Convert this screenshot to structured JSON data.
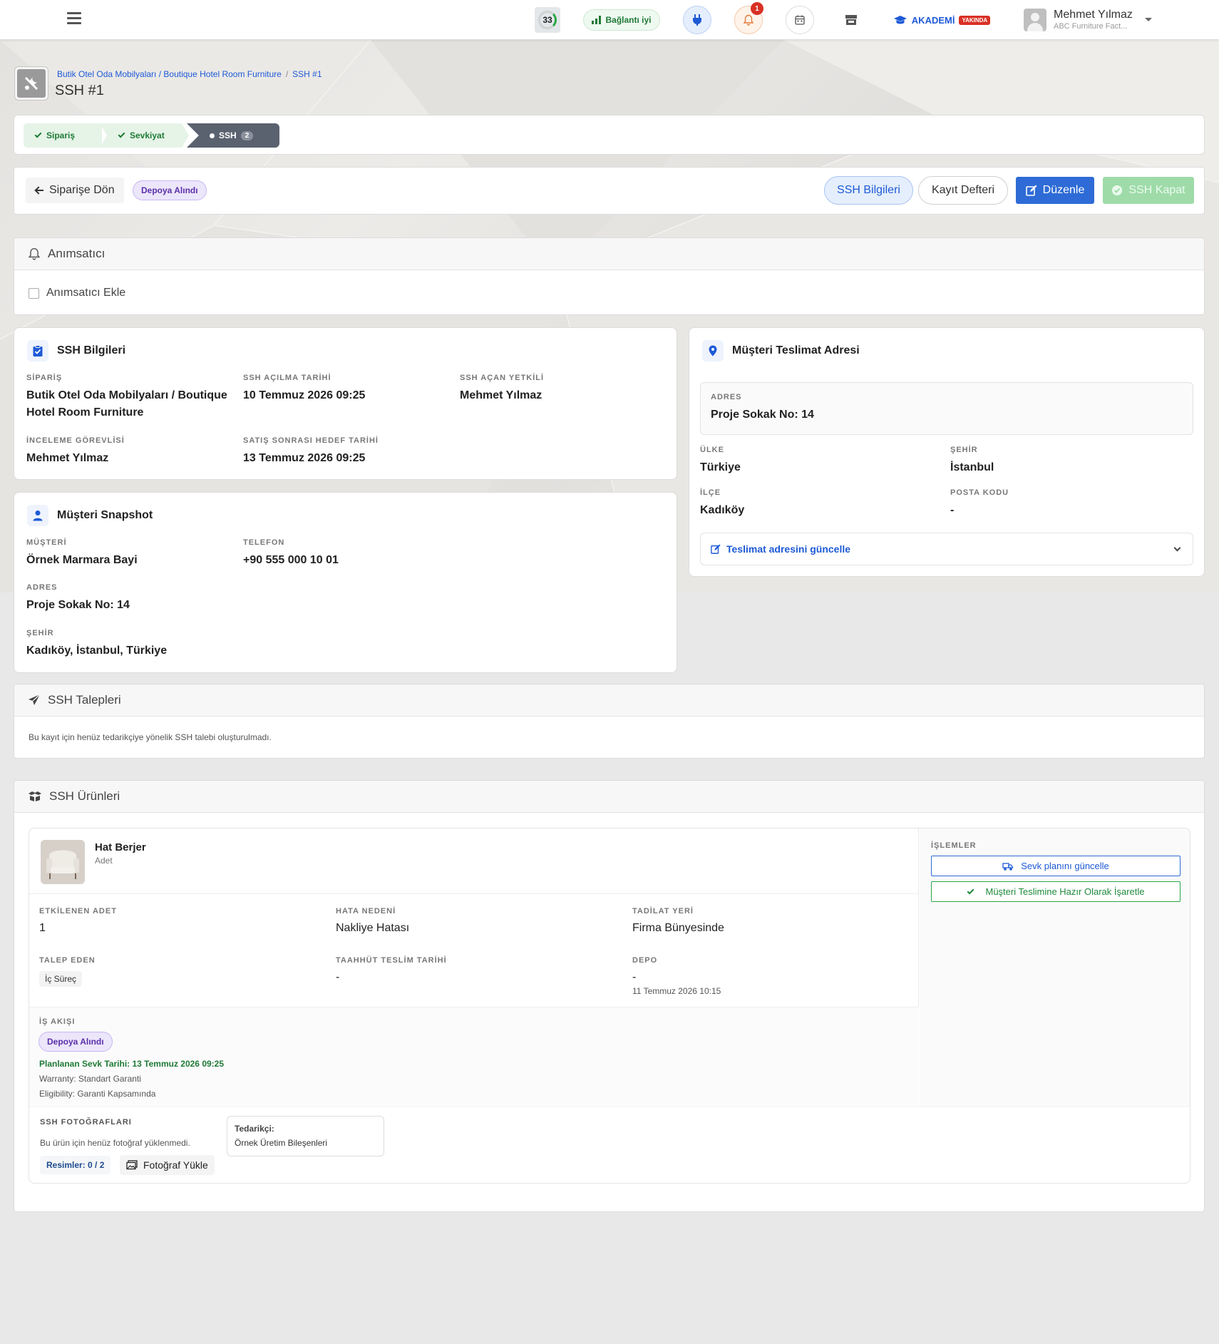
{
  "topbar": {
    "counter": "33",
    "connection": "Bağlantı iyi",
    "notification_count": "1",
    "akademi": "AKADEMİ",
    "akademi_badge": "YAKINDA",
    "user_name": "Mehmet Yılmaz",
    "user_company": "ABC Furniture Fact..."
  },
  "header": {
    "breadcrumb": [
      "Butik Otel Oda Mobilyaları / Boutique Hotel Room Furniture",
      "SSH #1"
    ],
    "title": "SSH #1"
  },
  "steps": [
    {
      "label": "Sipariş",
      "state": "done"
    },
    {
      "label": "Sevkiyat",
      "state": "done"
    },
    {
      "label": "SSH",
      "state": "active",
      "count": "2"
    }
  ],
  "actions": {
    "back": "Siparişe Dön",
    "status": "Depoya Alındı",
    "info": "SSH Bilgileri",
    "log": "Kayıt Defteri",
    "edit": "Düzenle",
    "close": "SSH Kapat"
  },
  "reminder": {
    "title": "Anımsatıcı",
    "add": "Anımsatıcı Ekle"
  },
  "ssh_info": {
    "title": "SSH Bilgileri",
    "fields": [
      {
        "label": "SİPARİŞ",
        "value": "Butik Otel Oda Mobilyaları / Boutique Hotel Room Furniture"
      },
      {
        "label": "SSH AÇILMA TARİHİ",
        "value": "10 Temmuz 2026 09:25"
      },
      {
        "label": "SSH AÇAN YETKİLİ",
        "value": "Mehmet Yılmaz"
      },
      {
        "label": "İNCELEME GÖREVLİSİ",
        "value": "Mehmet Yılmaz"
      },
      {
        "label": "SATIŞ SONRASI HEDEF TARİHİ",
        "value": "13 Temmuz 2026 09:25"
      }
    ]
  },
  "customer": {
    "title": "Müşteri Snapshot",
    "fields": [
      {
        "label": "MÜŞTERİ",
        "value": "Örnek Marmara Bayi"
      },
      {
        "label": "TELEFON",
        "value": "+90 555 000 10 01"
      },
      {
        "label": "ADRES",
        "value": "Proje Sokak No: 14"
      },
      {
        "label": "ŞEHİR",
        "value": "Kadıköy, İstanbul, Türkiye"
      }
    ]
  },
  "delivery": {
    "title": "Müşteri Teslimat Adresi",
    "address_label": "ADRES",
    "address": "Proje Sokak No: 14",
    "fields": [
      {
        "label": "ÜLKE",
        "value": "Türkiye"
      },
      {
        "label": "ŞEHİR",
        "value": "İstanbul"
      },
      {
        "label": "İLÇE",
        "value": "Kadıköy"
      },
      {
        "label": "POSTA KODU",
        "value": "-"
      }
    ],
    "update": "Teslimat adresini güncelle"
  },
  "requests": {
    "title": "SSH Talepleri",
    "empty": "Bu kayıt için henüz tedarikçiye yönelik SSH talebi oluşturulmadı."
  },
  "products": {
    "title": "SSH Ürünleri",
    "item": {
      "name": "Hat Berjer",
      "unit": "Adet",
      "fields": [
        {
          "label": "ETKİLENEN ADET",
          "value": "1"
        },
        {
          "label": "HATA NEDENİ",
          "value": "Nakliye Hatası"
        },
        {
          "label": "TADİLAT YERİ",
          "value": "Firma Bünyesinde"
        },
        {
          "label": "TALEP EDEN",
          "value": "İç Süreç"
        },
        {
          "label": "TAAHHÜT TESLİM TARİHİ",
          "value": "-"
        },
        {
          "label": "DEPO",
          "value": "-",
          "sub": "11 Temmuz 2026 10:15"
        }
      ],
      "workflow": {
        "label": "İŞ AKIŞI",
        "status": "Depoya Alındı",
        "planned": "Planlanan Sevk Tarihi: 13 Temmuz 2026 09:25",
        "warranty": "Warranty: Standart Garanti",
        "eligibility": "Eligibility: Garanti Kapsamında"
      },
      "ops": {
        "label": "İŞLEMLER",
        "plan": "Sevk planını güncelle",
        "ready": "Müşteri Teslimine Hazır Olarak İşaretle"
      },
      "photos": {
        "label": "SSH FOTOĞRAFLARI",
        "empty": "Bu ürün için henüz fotoğraf yüklenmedi.",
        "count": "Resimler: 0 / 2",
        "upload": "Fotoğraf Yükle"
      },
      "supplier": {
        "label": "Tedarikçi:",
        "value": "Örnek Üretim Bileşenleri"
      }
    }
  },
  "colors": {
    "primary": "#2e6bd6",
    "success": "#28a745",
    "status_purple": "#5a2fa8",
    "danger": "#d93025"
  }
}
